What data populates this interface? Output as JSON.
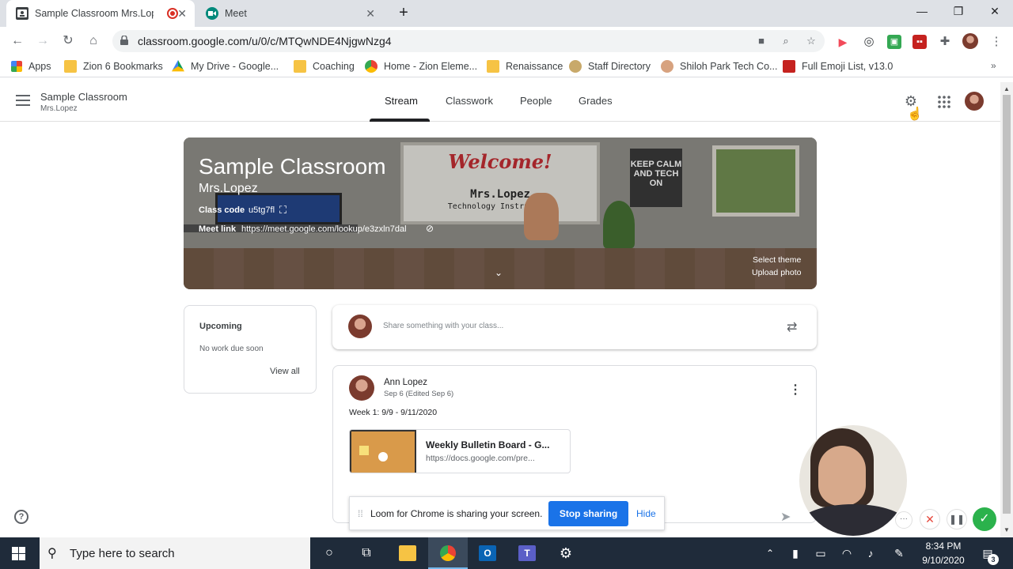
{
  "browser": {
    "tabs": [
      {
        "title": "Sample Classroom Mrs.Lope",
        "active": true
      },
      {
        "title": "Meet",
        "active": false
      }
    ],
    "url": "classroom.google.com/u/0/c/MTQwNDE4NjgwNzg4",
    "bookmarks": [
      "Apps",
      "Zion 6 Bookmarks",
      "My Drive - Google...",
      "Coaching",
      "Home - Zion Eleme...",
      "Renaissance",
      "Staff Directory",
      "Shiloh Park Tech Co...",
      "Full Emoji List, v13.0"
    ]
  },
  "classroom": {
    "class_name": "Sample Classroom",
    "teacher": "Mrs.Lopez",
    "nav_tabs": [
      "Stream",
      "Classwork",
      "People",
      "Grades"
    ],
    "banner": {
      "title": "Sample Classroom",
      "subtitle": "Mrs.Lopez",
      "class_code_label": "Class code",
      "class_code": "u5tg7fl",
      "meet_label": "Meet link",
      "meet_url": "https://meet.google.com/lookup/e3zxln7dal",
      "select_theme": "Select theme",
      "upload_photo": "Upload photo",
      "board_welcome": "Welcome!",
      "board_name": "Mrs.Lopez",
      "board_role": "Technology Instruction",
      "poster": "KEEP CALM AND TECH ON"
    },
    "upcoming": {
      "title": "Upcoming",
      "empty_text": "No work due soon",
      "view_all": "View all"
    },
    "share_placeholder": "Share something with your class...",
    "post": {
      "author": "Ann Lopez",
      "date": "Sep 6 (Edited Sep 6)",
      "text": "Week 1: 9/9 - 9/11/2020",
      "attachment_title": "Weekly Bulletin Board - G...",
      "attachment_url": "https://docs.google.com/pre..."
    }
  },
  "loom": {
    "message": "Loom for Chrome is sharing your screen.",
    "stop_label": "Stop sharing",
    "hide_label": "Hide"
  },
  "taskbar": {
    "search_placeholder": "Type here to search",
    "time": "8:34 PM",
    "date": "9/10/2020",
    "notification_count": "3"
  },
  "colors": {
    "accent_blue": "#1a73e8",
    "loom_red": "#e6483d",
    "loom_green": "#2bb24c",
    "taskbar_bg": "#1f2b3a"
  }
}
